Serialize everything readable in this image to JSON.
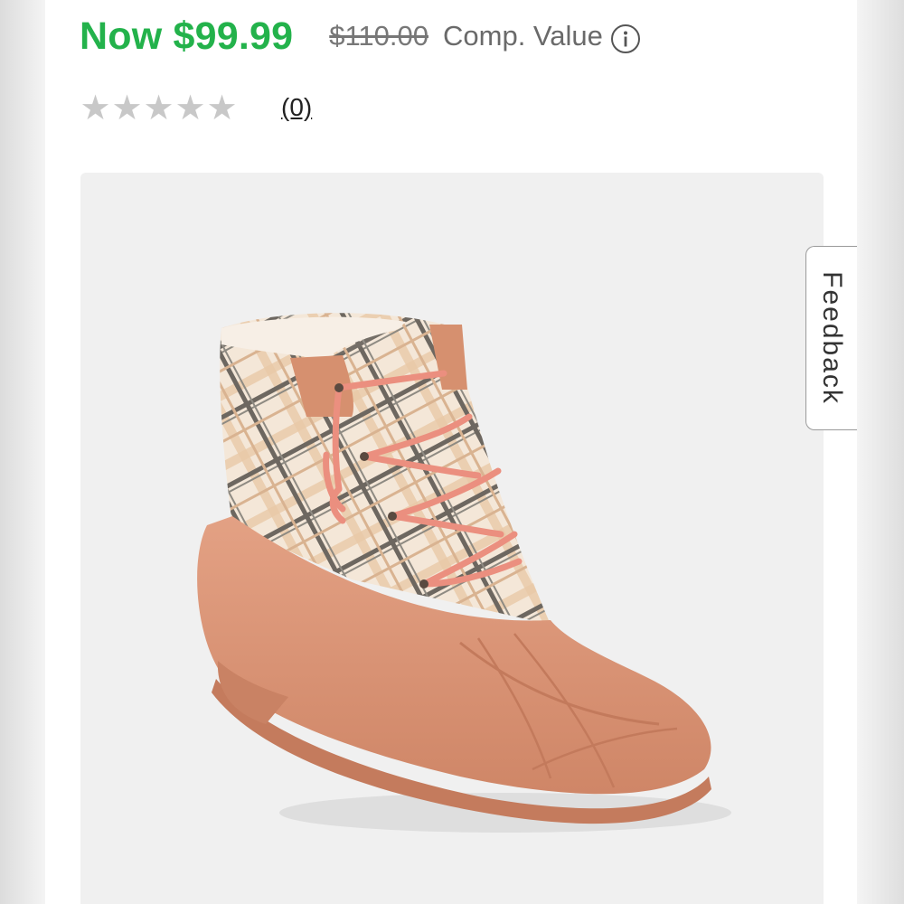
{
  "pricing": {
    "now_price": "Now $99.99",
    "compare_price": "$110.00",
    "compare_label": "Comp. Value"
  },
  "rating": {
    "stars_filled": 0,
    "stars_total": 5,
    "review_count": "(0)"
  },
  "feedback": {
    "label": "Feedback"
  },
  "colors": {
    "price_green": "#23b24b",
    "star_empty": "#c8c8c8",
    "boot_rubber": "#d99477",
    "lace": "#eb8f7f"
  },
  "product_image": {
    "subject": "duck-boot-icon"
  }
}
